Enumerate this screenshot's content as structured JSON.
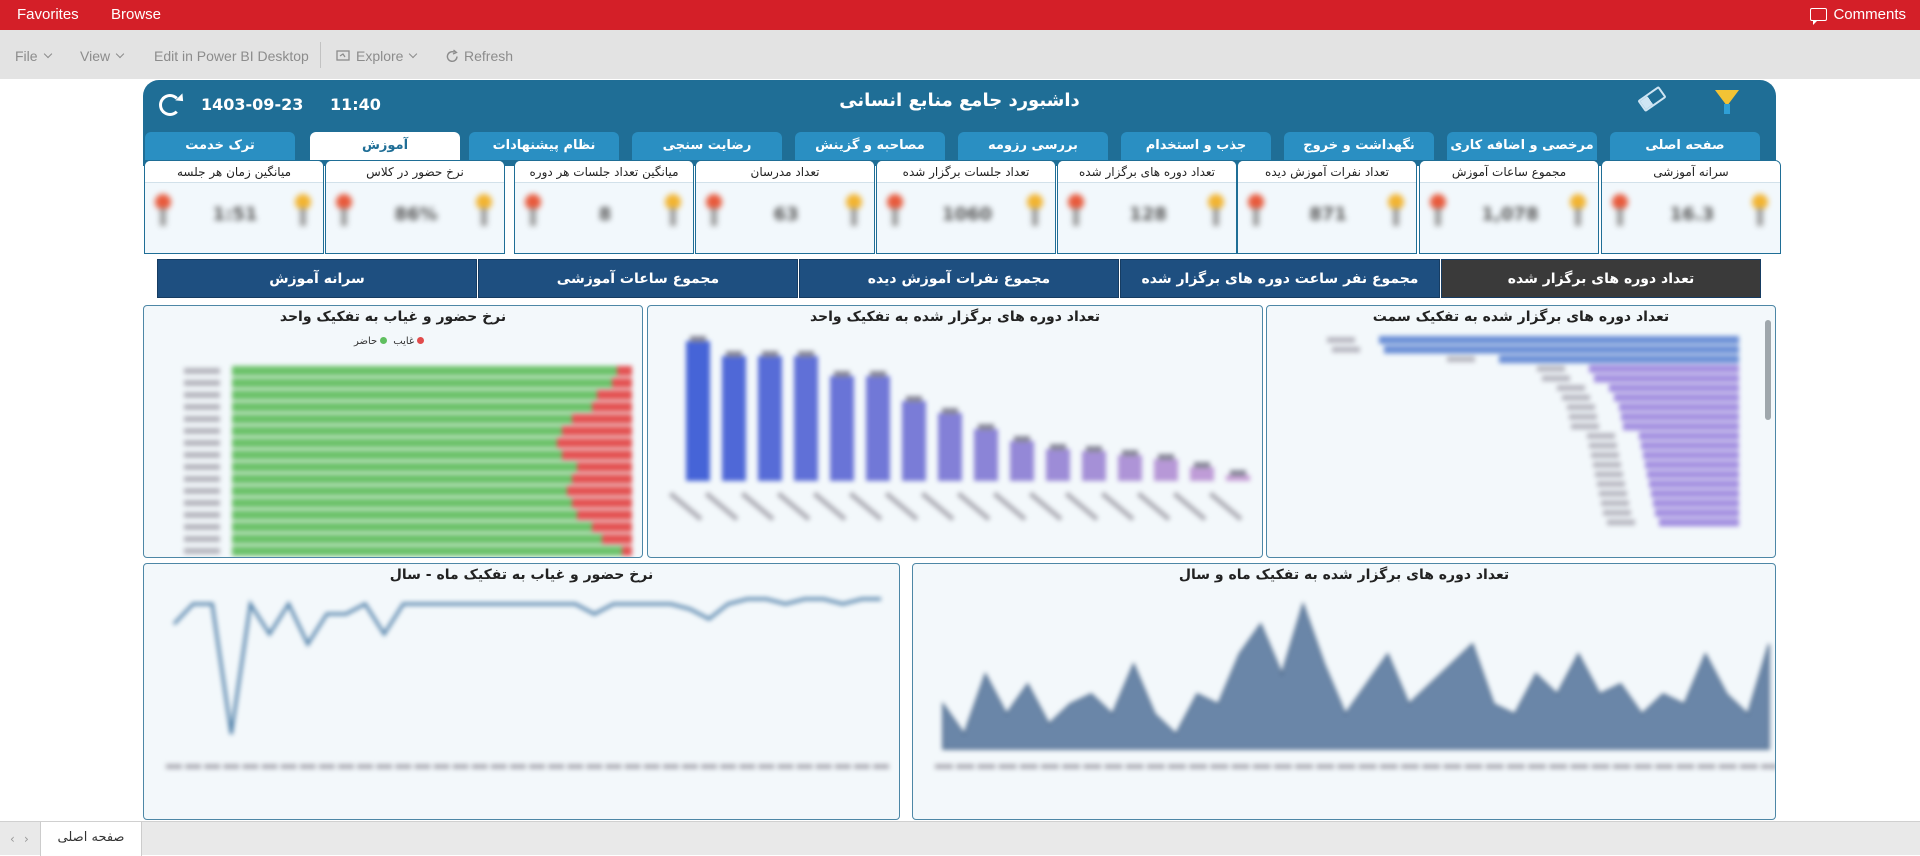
{
  "topbar": {
    "favorites": "Favorites",
    "browse": "Browse",
    "comments": "Comments"
  },
  "cmdbar": {
    "file": "File",
    "view": "View",
    "edit": "Edit in Power BI Desktop",
    "explore": "Explore",
    "refresh": "Refresh"
  },
  "header": {
    "title": "داشبورد جامع منابع انسانی",
    "date": "1403-09-23",
    "time": "11:40"
  },
  "tabs": [
    "صفحه اصلی",
    "مرخصی و اضافه کاری",
    "نگهداشت و خروج",
    "جذب و استخدام",
    "بررسی رزومه",
    "مصاحبه و گزینش",
    "رضایت سنجی",
    "نظام پیشنهادات",
    "آموزش",
    "ترک خدمت"
  ],
  "active_tab": "آموزش",
  "kpis": [
    {
      "title": "سرانه آموزشی",
      "value": "16.3"
    },
    {
      "title": "مجموع ساعات آموزش",
      "value": "1,078"
    },
    {
      "title": "تعداد نفرات آموزش دیده",
      "value": "871"
    },
    {
      "title": "تعداد دوره های برگزار شده",
      "value": "128"
    },
    {
      "title": "تعداد جلسات برگزار شده",
      "value": "1060"
    },
    {
      "title": "تعداد مدرسان",
      "value": "63"
    },
    {
      "title": "میانگین تعداد جلسات هر دوره",
      "value": "8"
    },
    {
      "title": "نرخ حضور در کلاس",
      "value": "86%"
    },
    {
      "title": "میانگین زمان هر جلسه",
      "value": "1:51"
    }
  ],
  "metric_buttons": [
    "تعداد دوره های برگزار شده",
    "مجموع نفر ساعت دوره های برگزار شده",
    "مجموع نفرات آموزش دیده",
    "مجموع ساعات آموزشی",
    "سرانه آموزش"
  ],
  "charts": {
    "by_position": {
      "title": "تعداد دوره های برگزار شده به تفکیک سمت"
    },
    "by_unit": {
      "title": "تعداد دوره های برگزار شده به تفکیک واحد"
    },
    "attendance_unit": {
      "title": "نرخ حضور و غیاب به تفکیک واحد",
      "legend_absent": "غایب",
      "legend_present": "حاضر"
    },
    "by_month": {
      "title": "تعداد دوره های برگزار شده به تفکیک ماه و سال"
    },
    "attendance_month": {
      "title": "نرخ حضور و غیاب به تفکیک ماه - سال"
    }
  },
  "colors": {
    "brand": "#d41f28",
    "header": "#1f6e96",
    "tab": "#2a8fc2",
    "metric_button": "#1e4f80",
    "metric_button_active": "#3a3a3a",
    "present": "#5fbf5f",
    "absent": "#e14b4b"
  },
  "pagebar": {
    "tab": "صفحه اصلی"
  }
}
